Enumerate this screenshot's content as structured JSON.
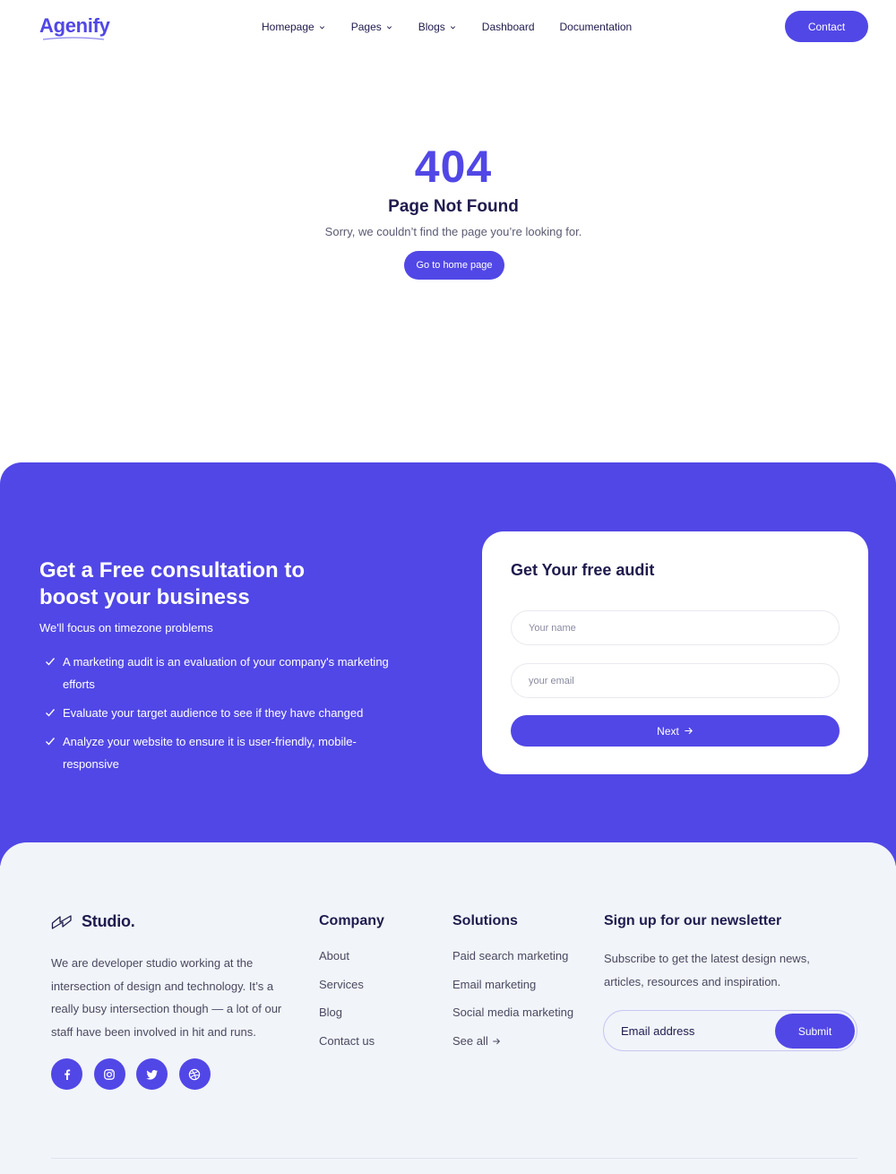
{
  "brand": {
    "name": "Agenify",
    "color": "#5147e6"
  },
  "nav": {
    "items": [
      {
        "label": "Homepage",
        "dropdown": true
      },
      {
        "label": "Pages",
        "dropdown": true
      },
      {
        "label": "Blogs",
        "dropdown": true
      },
      {
        "label": "Dashboard",
        "dropdown": false
      },
      {
        "label": "Documentation",
        "dropdown": false
      }
    ],
    "contact_label": "Contact"
  },
  "error": {
    "code": "404",
    "title": "Page Not Found",
    "message": "Sorry, we couldn’t find the page you’re looking for.",
    "button_label": "Go to home page"
  },
  "cta": {
    "title": "Get a Free consultation to boost your business",
    "subtitle": "We'll focus on timezone problems",
    "points": [
      "A marketing audit is an evaluation of your company's marketing efforts",
      "Evaluate your target audience to see if they have changed",
      "Analyze your website to ensure it is user-friendly, mobile-responsive"
    ],
    "form": {
      "title": "Get Your free audit",
      "name_placeholder": "Your name",
      "email_placeholder": "your email",
      "next_label": "Next"
    }
  },
  "footer": {
    "studio_name": "Studio.",
    "description": "We are developer studio working at the intersection of design and technology. It’s a really busy intersection though — a lot of our staff have been involved in hit and runs.",
    "socials": [
      "facebook-icon",
      "instagram-icon",
      "twitter-icon",
      "dribbble-icon"
    ],
    "company": {
      "title": "Company",
      "links": [
        "About",
        "Services",
        "Blog",
        "Contact us"
      ]
    },
    "solutions": {
      "title": "Solutions",
      "links": [
        "Paid search marketing",
        "Email marketing",
        "Social media marketing",
        "See all"
      ]
    },
    "newsletter": {
      "title": "Sign up for our newsletter",
      "description": "Subscribe to get the latest design news, articles, resources and inspiration.",
      "email_placeholder": "Email address",
      "submit_label": "Submit"
    }
  }
}
